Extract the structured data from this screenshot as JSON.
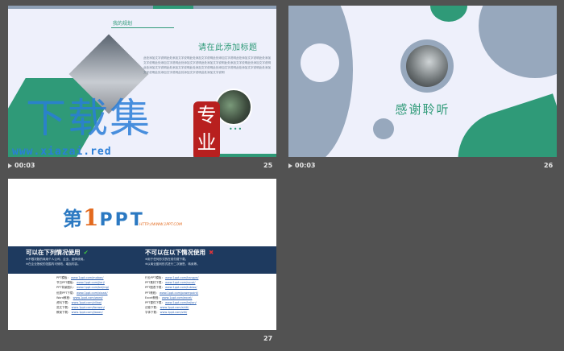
{
  "colors": {
    "background": "#525252",
    "green": "#2f9a78",
    "slate": "#97a8bd",
    "blue": "#1e3a5f"
  },
  "slides": [
    {
      "number": "25",
      "duration": "00:03",
      "pill_label": "我的规划",
      "title": "请在此添加标题",
      "body": "此处添加文字说明此处添加文字说明此处添加文字说明此处添加文字说明此处添加文字说明此处添加文字说明此处添加文字说明此处添加文字说明此处添加文字说明此处添加文字说明此处添加文字说明此处添加文字说明此处添加文字说明此处添加文字说明此处添加文字说明此处添加文字说明此处添加文字说明此处添加文字说明此处添加文字说明此处添加文字说明",
      "dots": "•••",
      "watermark_text": "下载集",
      "watermark_seal": "专业",
      "watermark_url": "www.xiazai.red"
    },
    {
      "number": "26",
      "duration": "00:03",
      "thanks": "感谢聆听"
    },
    {
      "number": "27",
      "logo_prefix": "第",
      "logo_one": "1",
      "logo_ppt": "PPT",
      "site": "HTTP://WWW.1PPT.COM",
      "can_title": "可以在下列情况使用",
      "can_mark": "✔",
      "can_lines": [
        "※不限次数的商用个人公司、企业、团体使用。",
        "※在企业授权的范围内可修改、增加内容。"
      ],
      "cannot_title": "不可以在以下情况使用",
      "cannot_mark": "✖",
      "cannot_lines": [
        "※用于任何形式的在线付费下载。",
        "※以商业盈利形式进行二次销售、转卖等。"
      ],
      "links_left": [
        [
          "PPT模板：",
          "www.1ppt.com/moban/"
        ],
        [
          "节日PPT模板：",
          "www.1ppt.com/jieri/"
        ],
        [
          "PPT背景图片：",
          "www.1ppt.com/beijing/"
        ],
        [
          "优秀PPT下载：",
          "www.1ppt.com/xiazai/"
        ],
        [
          "Word教程：",
          "www.1ppt.com/word/"
        ],
        [
          "资料下载：",
          "www.1ppt.com/ziliao/"
        ],
        [
          "范文下载：",
          "www.1ppt.com/fanwen/"
        ],
        [
          "教案下载：",
          "www.1ppt.com/jiaoan/"
        ]
      ],
      "links_right": [
        [
          "行业PPT模板：",
          "www.1ppt.com/hangye/"
        ],
        [
          "PPT素材下载：",
          "www.1ppt.com/sucai/"
        ],
        [
          "PPT图表下载：",
          "www.1ppt.com/tubiao/"
        ],
        [
          "PPT教程：",
          "www.1ppt.com/powerpoint/"
        ],
        [
          "Excel教程：",
          "www.1ppt.com/excel/"
        ],
        [
          "PPT课件下载：",
          "www.1ppt.com/kejian/"
        ],
        [
          "试卷下载：",
          "www.1ppt.com/shiti/"
        ],
        [
          "字体下载：",
          "www.1ppt.com/ziti/"
        ]
      ]
    }
  ]
}
